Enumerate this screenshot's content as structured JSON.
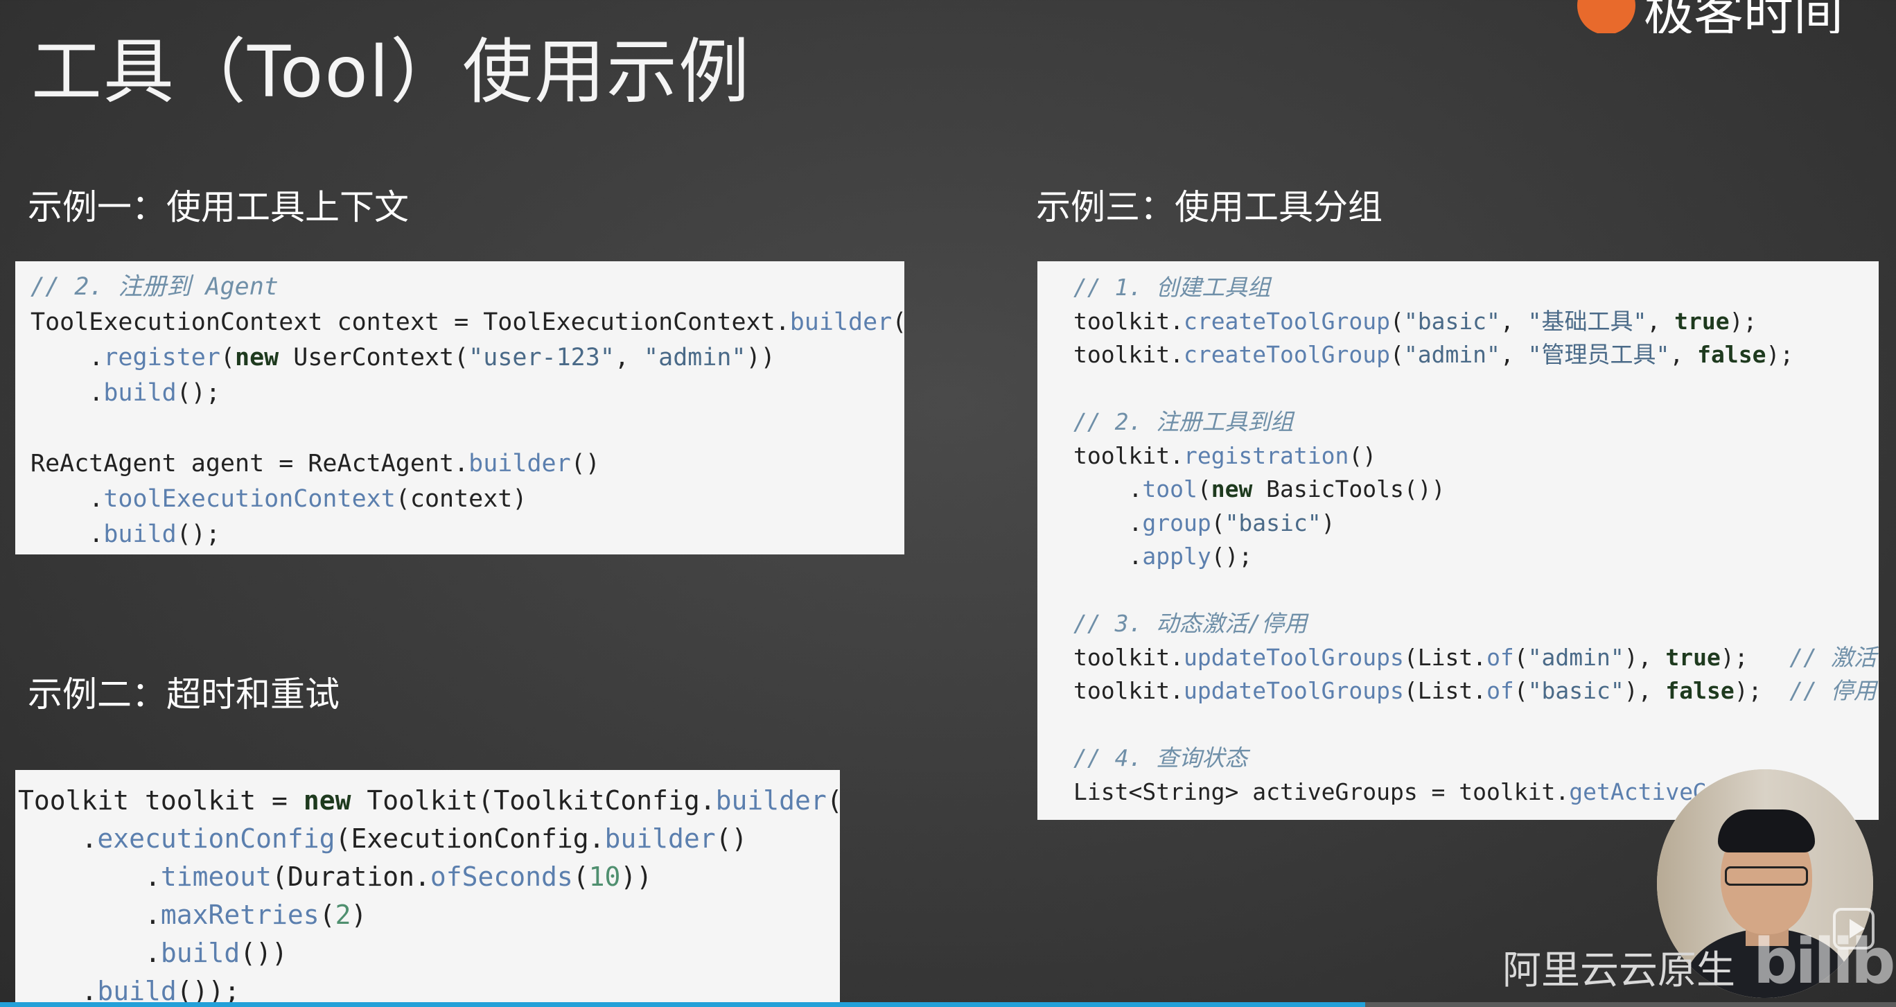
{
  "page_title": "工具（Tool）使用示例",
  "logo": {
    "text": "极客时间"
  },
  "examples": {
    "ex1": {
      "heading": "示例一：使用工具上下文"
    },
    "ex2": {
      "heading": "示例二：超时和重试"
    },
    "ex3": {
      "heading": "示例三：使用工具分组"
    }
  },
  "code1": [
    [
      [
        "c",
        "// 2. 注册到 Agent"
      ]
    ],
    [
      [
        "t",
        "ToolExecutionContext context = ToolExecutionContext."
      ],
      [
        "m",
        "builder"
      ],
      [
        "t",
        "()"
      ]
    ],
    [
      [
        "t",
        "    ."
      ],
      [
        "m",
        "register"
      ],
      [
        "t",
        "("
      ],
      [
        "k",
        "new"
      ],
      [
        "t",
        " UserContext("
      ],
      [
        "s",
        "\"user-123\""
      ],
      [
        "t",
        ", "
      ],
      [
        "s",
        "\"admin\""
      ],
      [
        "t",
        "))"
      ]
    ],
    [
      [
        "t",
        "    ."
      ],
      [
        "m",
        "build"
      ],
      [
        "t",
        "();"
      ]
    ],
    [
      [
        "t",
        ""
      ]
    ],
    [
      [
        "t",
        "ReActAgent agent = ReActAgent."
      ],
      [
        "m",
        "builder"
      ],
      [
        "t",
        "()"
      ]
    ],
    [
      [
        "t",
        "    ."
      ],
      [
        "m",
        "toolExecutionContext"
      ],
      [
        "t",
        "(context)"
      ]
    ],
    [
      [
        "t",
        "    ."
      ],
      [
        "m",
        "build"
      ],
      [
        "t",
        "();"
      ]
    ]
  ],
  "code2": [
    [
      [
        "c",
        "// 1. 创建工具组"
      ]
    ],
    [
      [
        "t",
        "toolkit."
      ],
      [
        "m",
        "createToolGroup"
      ],
      [
        "t",
        "("
      ],
      [
        "s",
        "\"basic\""
      ],
      [
        "t",
        ", "
      ],
      [
        "s",
        "\"基础工具\""
      ],
      [
        "t",
        ", "
      ],
      [
        "k",
        "true"
      ],
      [
        "t",
        ");"
      ]
    ],
    [
      [
        "t",
        "toolkit."
      ],
      [
        "m",
        "createToolGroup"
      ],
      [
        "t",
        "("
      ],
      [
        "s",
        "\"admin\""
      ],
      [
        "t",
        ", "
      ],
      [
        "s",
        "\"管理员工具\""
      ],
      [
        "t",
        ", "
      ],
      [
        "k",
        "false"
      ],
      [
        "t",
        ");"
      ]
    ],
    [
      [
        "t",
        ""
      ]
    ],
    [
      [
        "c",
        "// 2. 注册工具到组"
      ]
    ],
    [
      [
        "t",
        "toolkit."
      ],
      [
        "m",
        "registration"
      ],
      [
        "t",
        "()"
      ]
    ],
    [
      [
        "t",
        "    ."
      ],
      [
        "m",
        "tool"
      ],
      [
        "t",
        "("
      ],
      [
        "k",
        "new"
      ],
      [
        "t",
        " BasicTools())"
      ]
    ],
    [
      [
        "t",
        "    ."
      ],
      [
        "m",
        "group"
      ],
      [
        "t",
        "("
      ],
      [
        "s",
        "\"basic\""
      ],
      [
        "t",
        ")"
      ]
    ],
    [
      [
        "t",
        "    ."
      ],
      [
        "m",
        "apply"
      ],
      [
        "t",
        "();"
      ]
    ],
    [
      [
        "t",
        ""
      ]
    ],
    [
      [
        "c",
        "// 3. 动态激活/停用"
      ]
    ],
    [
      [
        "t",
        "toolkit."
      ],
      [
        "m",
        "updateToolGroups"
      ],
      [
        "t",
        "(List."
      ],
      [
        "m",
        "of"
      ],
      [
        "t",
        "("
      ],
      [
        "s",
        "\"admin\""
      ],
      [
        "t",
        "), "
      ],
      [
        "k",
        "true"
      ],
      [
        "t",
        ");   "
      ],
      [
        "c",
        "// 激活"
      ]
    ],
    [
      [
        "t",
        "toolkit."
      ],
      [
        "m",
        "updateToolGroups"
      ],
      [
        "t",
        "(List."
      ],
      [
        "m",
        "of"
      ],
      [
        "t",
        "("
      ],
      [
        "s",
        "\"basic\""
      ],
      [
        "t",
        "), "
      ],
      [
        "k",
        "false"
      ],
      [
        "t",
        ");  "
      ],
      [
        "c",
        "// 停用"
      ]
    ],
    [
      [
        "t",
        ""
      ]
    ],
    [
      [
        "c",
        "// 4. 查询状态"
      ]
    ],
    [
      [
        "t",
        "List<String> activeGroups = toolkit."
      ],
      [
        "m",
        "getActiveGr"
      ]
    ]
  ],
  "code3": [
    [
      [
        "t",
        "Toolkit toolkit = "
      ],
      [
        "k",
        "new"
      ],
      [
        "t",
        " Toolkit(ToolkitConfig."
      ],
      [
        "m",
        "builder"
      ],
      [
        "t",
        "()"
      ]
    ],
    [
      [
        "t",
        "    ."
      ],
      [
        "m",
        "executionConfig"
      ],
      [
        "t",
        "(ExecutionConfig."
      ],
      [
        "m",
        "builder"
      ],
      [
        "t",
        "()"
      ]
    ],
    [
      [
        "t",
        "        ."
      ],
      [
        "m",
        "timeout"
      ],
      [
        "t",
        "(Duration."
      ],
      [
        "m",
        "ofSeconds"
      ],
      [
        "t",
        "("
      ],
      [
        "n",
        "10"
      ],
      [
        "t",
        "))"
      ]
    ],
    [
      [
        "t",
        "        ."
      ],
      [
        "m",
        "maxRetries"
      ],
      [
        "t",
        "("
      ],
      [
        "n",
        "2"
      ],
      [
        "t",
        ")"
      ]
    ],
    [
      [
        "t",
        "        ."
      ],
      [
        "m",
        "build"
      ],
      [
        "t",
        "())"
      ]
    ],
    [
      [
        "t",
        "    ."
      ],
      [
        "m",
        "build"
      ],
      [
        "t",
        "());"
      ]
    ]
  ],
  "watermark": "阿里云云原生",
  "bilibili_logo": "bilibili",
  "presenter_video": {
    "icon": "presenter-avatar"
  },
  "video_progress": {
    "played_fraction": 0.72
  },
  "colors": {
    "accent": "#23a0d8",
    "background": "#3a3a3a",
    "code_bg": "#f5f5f5"
  }
}
